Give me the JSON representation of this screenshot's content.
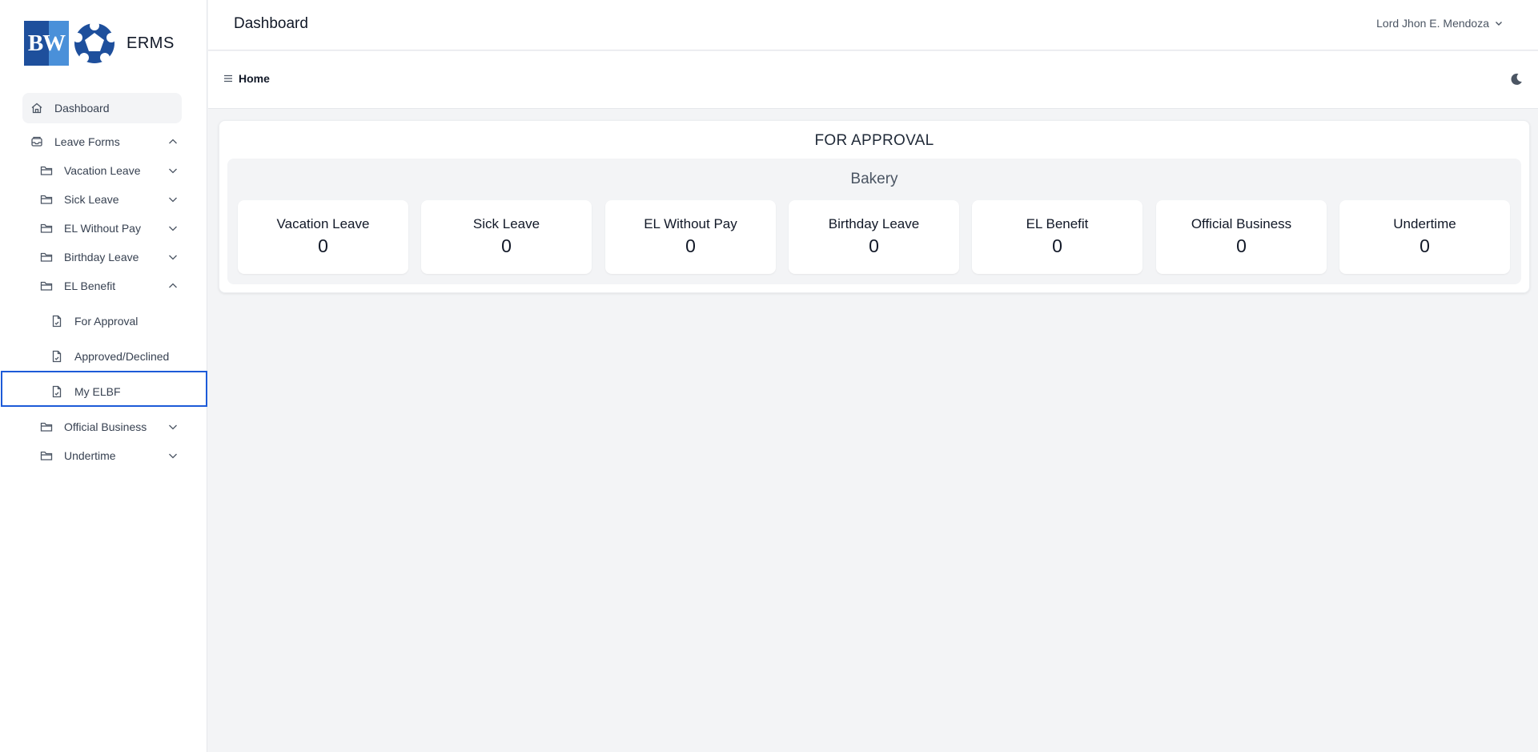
{
  "app": {
    "logo_initials": "BW",
    "name": "ERMS"
  },
  "header": {
    "title": "Dashboard",
    "user_name": "Lord Jhon E. Mendoza"
  },
  "breadcrumb": {
    "current": "Home"
  },
  "sidebar": {
    "dashboard": "Dashboard",
    "leave_forms": "Leave Forms",
    "vacation_leave": "Vacation Leave",
    "sick_leave": "Sick Leave",
    "el_without_pay": "EL Without Pay",
    "birthday_leave": "Birthday Leave",
    "el_benefit": "EL Benefit",
    "el_benefit_children": [
      "For Approval",
      "Approved/Declined",
      "My ELBF"
    ],
    "official_business": "Official Business",
    "undertime": "Undertime"
  },
  "panel": {
    "title": "FOR APPROVAL",
    "group_title": "Bakery",
    "cards": [
      {
        "label": "Vacation Leave",
        "value": "0"
      },
      {
        "label": "Sick Leave",
        "value": "0"
      },
      {
        "label": "EL Without Pay",
        "value": "0"
      },
      {
        "label": "Birthday Leave",
        "value": "0"
      },
      {
        "label": "EL Benefit",
        "value": "0"
      },
      {
        "label": "Official Business",
        "value": "0"
      },
      {
        "label": "Undertime",
        "value": "0"
      }
    ]
  },
  "colors": {
    "accent": "#1d5bd8",
    "brand_dark": "#1e4f9c",
    "brand_light": "#4a90d9"
  }
}
